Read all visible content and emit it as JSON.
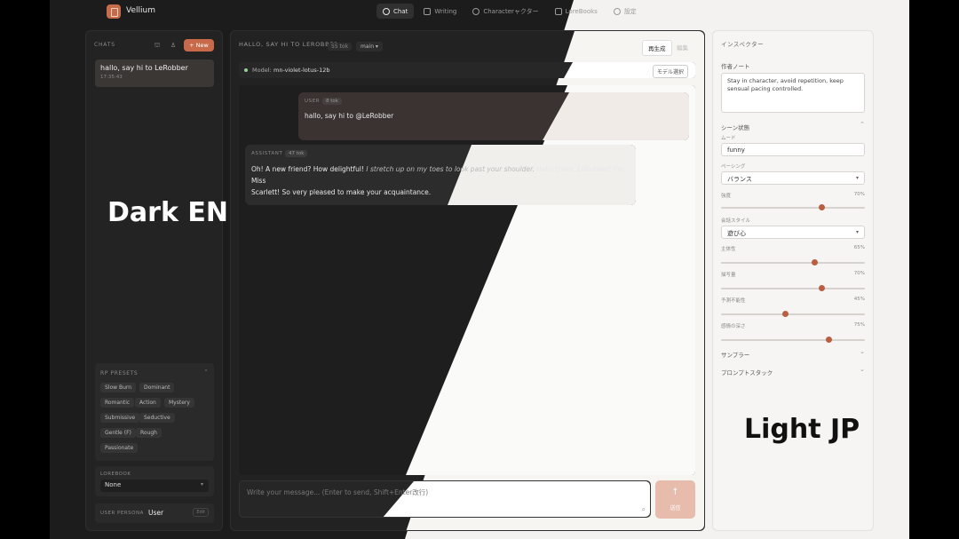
{
  "app": {
    "name": "Vellium"
  },
  "nav": [
    {
      "label": "Chat",
      "icon": "chat-bubble-icon",
      "active": true
    },
    {
      "label": "Writing",
      "icon": "pencil-icon",
      "active": false
    },
    {
      "label": "Characterャクター",
      "icon": "person-icon",
      "active": false
    },
    {
      "label": "LoreBooks",
      "icon": "book-icon",
      "active": false
    },
    {
      "label": "設定",
      "icon": "gear-icon",
      "active": false
    }
  ],
  "sidebar": {
    "header": "CHATS",
    "new_button": "+ New",
    "chats": [
      {
        "title": "hallo, say hi to LeRobber",
        "time": "17:35:43"
      }
    ],
    "presets": {
      "title": "RP PRESETS",
      "tags": [
        "Slow Burn",
        "Dominant",
        "Romantic",
        "Action",
        "Mystery",
        "Submissive",
        "Seductive",
        "Gentle (F)",
        "Rough",
        "Passionate"
      ]
    },
    "lorebook": {
      "label": "LOREBOOK",
      "value": "None"
    },
    "persona": {
      "label": "USER PERSONA",
      "value": "User",
      "edit": "Edit"
    }
  },
  "chat": {
    "title": "HALLO, SAY HI TO LEROBBER",
    "tokens": "55 tok",
    "branch": "main",
    "regenerate": "再生成",
    "edit": "編集",
    "model_label": "Model:",
    "model": "mn-violet-lotus-12b",
    "model_select": "モデル選択",
    "messages": [
      {
        "role": "USER",
        "tokens": "8 tok",
        "text": "hallo, say hi to @LeRobber"
      },
      {
        "role": "ASSISTANT",
        "tokens": "47 tok",
        "text_part1": "Oh! A new friend? How delightful!",
        "text_italic": "I stretch up on my toes to look past your shoulder.",
        "text_part2": "Hello there, LeRobber! I'm Miss",
        "text_line2": "Scarlett! So very pleased to make your acquaintance."
      }
    ],
    "composer_placeholder": "Write your message... (Enter to send, Shift+Enter改行)",
    "send_label": "送信"
  },
  "inspector": {
    "title": "インスペクター",
    "notes_label": "作者ノート",
    "notes": "Stay in character, avoid repetition, keep sensual pacing controlled.",
    "scene_title": "シーン状態",
    "mood_label": "ムード",
    "mood": "funny",
    "pacing_label": "ペーシング",
    "pacing": "バランス",
    "intensity_label": "強度",
    "intensity": "70%",
    "intensity_value": 0.7,
    "dialogue_label": "会話スタイル",
    "dialogue": "遊び心",
    "initiative_label": "主体性",
    "initiative": "65%",
    "initiative_value": 0.65,
    "descriptive_label": "描写量",
    "descriptive": "70%",
    "descriptive_value": 0.7,
    "unpredict_label": "予測不能性",
    "unpredict": "45%",
    "unpredict_value": 0.45,
    "emotion_label": "感情の深さ",
    "emotion": "75%",
    "emotion_value": 0.75,
    "sampler": "サンプラー",
    "prompt_stack": "プロンプトスタック"
  },
  "overlay": {
    "dark": "Dark EN",
    "light": "Light JP"
  },
  "colors": {
    "accent": "#c8694a",
    "dark_bg": "#1c1c1c",
    "light_bg": "#f3f2f0"
  }
}
